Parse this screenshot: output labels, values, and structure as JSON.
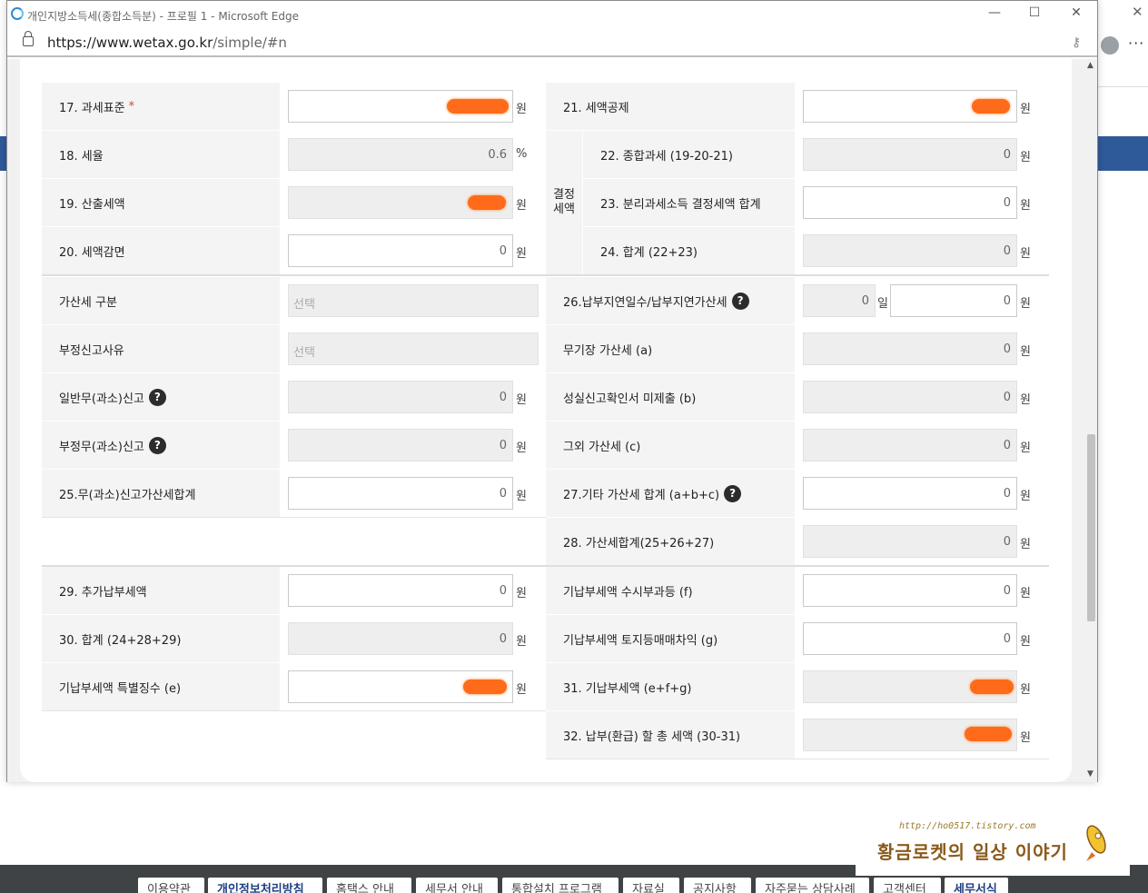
{
  "window": {
    "title": "개인지방소득세(종합소득분) - 프로필 1 - Microsoft Edge",
    "url_main": "https://www.wetax.go.kr",
    "url_path": "/simple/#n",
    "min_glyph": "—",
    "max_glyph": "☐",
    "close_glyph": "✕"
  },
  "units": {
    "won": "원",
    "percent": "%",
    "day": "일"
  },
  "form": {
    "r17": {
      "label": "17. 과세표준",
      "req": "*"
    },
    "r18": {
      "label": "18. 세율",
      "value": "0.6"
    },
    "r19": {
      "label": "19. 산출세액"
    },
    "r20": {
      "label": "20. 세액감면",
      "value": "0"
    },
    "r21": {
      "label": "21. 세액공제"
    },
    "group_label_1": "결정",
    "group_label_2": "세액",
    "r22": {
      "label": "22. 종합과세 (19-20-21)",
      "value": "0"
    },
    "r23": {
      "label": "23. 분리과세소득 결정세액 합계",
      "value": "0"
    },
    "r24": {
      "label": "24. 합계 (22+23)",
      "value": "0"
    },
    "penalty_type": {
      "label": "가산세 구분",
      "placeholder": "선택"
    },
    "fraud_reason": {
      "label": "부정신고사유",
      "placeholder": "선택"
    },
    "r26": {
      "label": "26.납부지연일수/납부지연가산세",
      "days": "0",
      "value": "0"
    },
    "general_under": {
      "label": "일반무(과소)신고",
      "value": "0"
    },
    "fraud_under": {
      "label": "부정무(과소)신고",
      "value": "0"
    },
    "r25": {
      "label": "25.무(과소)신고가산세합계",
      "value": "0"
    },
    "no_book": {
      "label": "무기장 가산세 (a)",
      "value": "0"
    },
    "faithful": {
      "label": "성실신고확인서 미제출 (b)",
      "value": "0"
    },
    "other_penalty": {
      "label": "그외 가산세 (c)",
      "value": "0"
    },
    "r27": {
      "label": "27.기타 가산세 합계 (a+b+c)",
      "value": "0"
    },
    "r28": {
      "label": "28. 가산세합계(25+26+27)",
      "value": "0"
    },
    "r29": {
      "label": "29. 추가납부세액",
      "value": "0"
    },
    "r30": {
      "label": "30. 합계 (24+28+29)",
      "value": "0"
    },
    "prepaid_e": {
      "label": "기납부세액 특별징수 (e)"
    },
    "prepaid_f": {
      "label": "기납부세액 수시부과등 (f)",
      "value": "0"
    },
    "prepaid_g": {
      "label": "기납부세액 토지등매매차익 (g)",
      "value": "0"
    },
    "r31": {
      "label": "31. 기납부세액 (e+f+g)"
    },
    "r32": {
      "label": "32. 납부(환급) 할 총 세액 (30-31)"
    },
    "help_glyph": "?"
  },
  "footer": {
    "items": [
      "이용약관",
      "개인정보처리방침",
      "홈택스 안내",
      "세무서 안내",
      "통합설치 프로그램",
      "자료실",
      "공지사항",
      "자주묻는 상담사례",
      "고객센터",
      "세무서식"
    ]
  },
  "watermark": {
    "url": "http://ho0517.tistory.com",
    "title": "황금로켓의 일상 이야기"
  },
  "colors": {
    "redaction": "#ff6b1a",
    "label_bg": "#f4f4f4",
    "footer_bg": "#3f4346"
  }
}
